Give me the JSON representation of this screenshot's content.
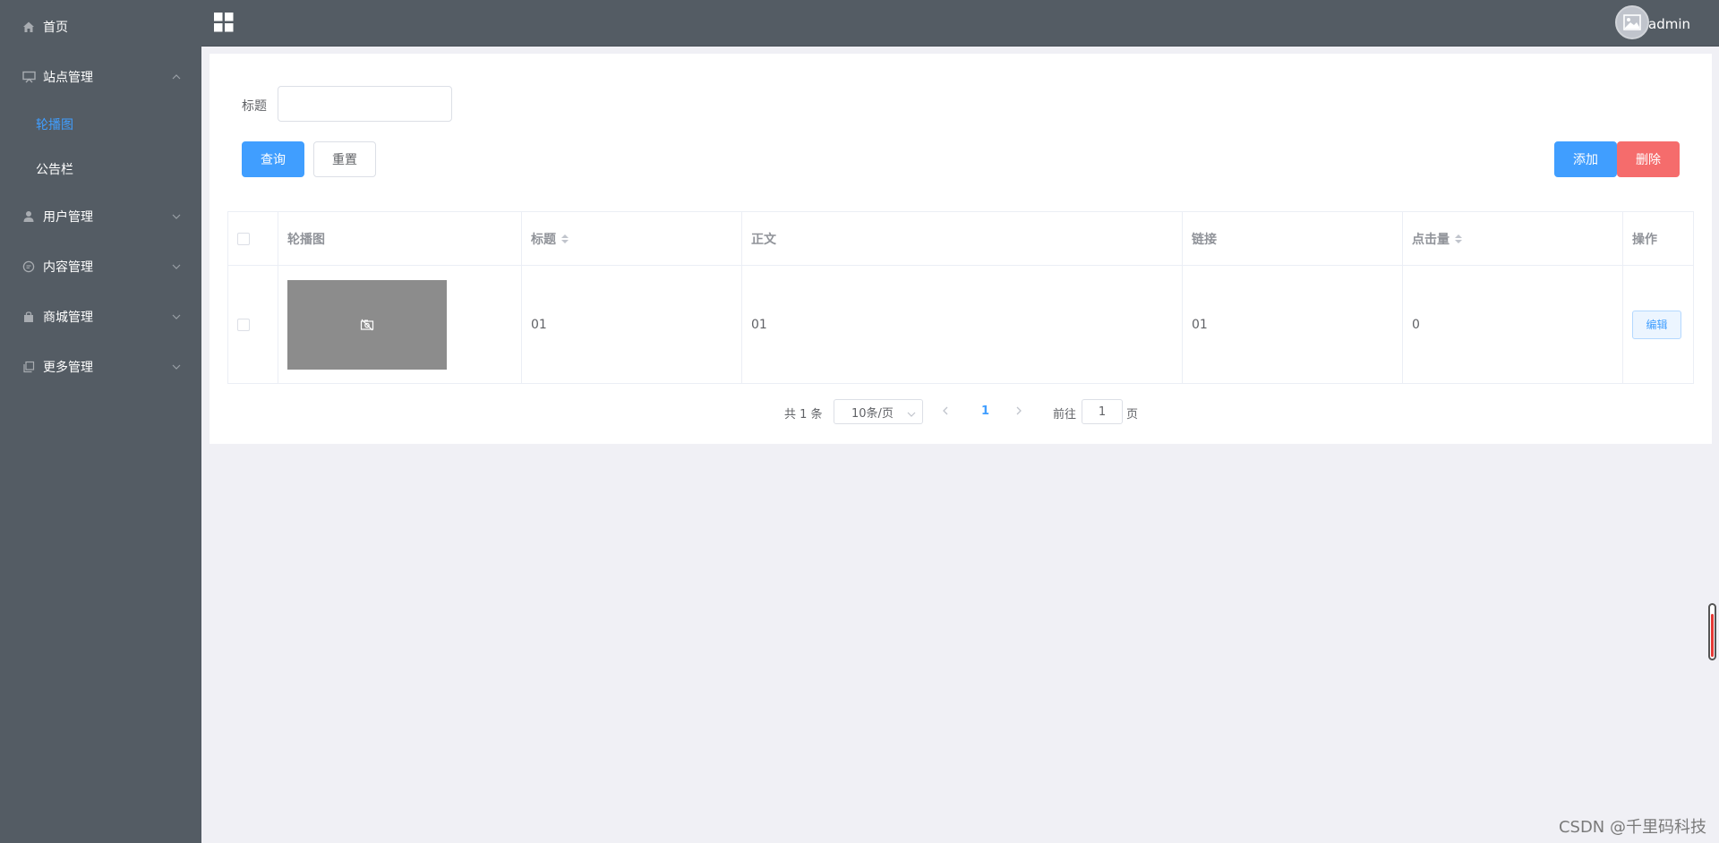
{
  "sidebar": {
    "items": [
      {
        "label": "首页",
        "icon": "home-icon"
      },
      {
        "label": "站点管理",
        "icon": "monitor-icon",
        "expanded": true
      },
      {
        "label": "用户管理",
        "icon": "user-icon"
      },
      {
        "label": "内容管理",
        "icon": "chat-icon"
      },
      {
        "label": "商城管理",
        "icon": "shop-bag-icon"
      },
      {
        "label": "更多管理",
        "icon": "copy-icon"
      }
    ],
    "sub_items": [
      {
        "label": "轮播图",
        "active": true
      },
      {
        "label": "公告栏",
        "active": false
      }
    ]
  },
  "header": {
    "username": "admin"
  },
  "filter": {
    "title_label": "标题",
    "title_value": "",
    "search_label": "查询",
    "reset_label": "重置",
    "add_label": "添加",
    "delete_label": "删除"
  },
  "table": {
    "columns": [
      "轮播图",
      "标题",
      "正文",
      "链接",
      "点击量",
      "操作"
    ],
    "rows": [
      {
        "title": "01",
        "body": "01",
        "link": "01",
        "clicks": "0",
        "action": "编辑"
      }
    ]
  },
  "pagination": {
    "total": "共 1 条",
    "page_size": "10条/页",
    "current_page": "1",
    "goto_label": "前往",
    "goto_value": "1",
    "page_suffix": "页"
  },
  "watermark": "CSDN @千里码科技",
  "colors": {
    "sidebar_bg": "#545c64",
    "primary": "#409eff",
    "danger": "#f56c6c",
    "page_bg": "#f0f0f5"
  }
}
